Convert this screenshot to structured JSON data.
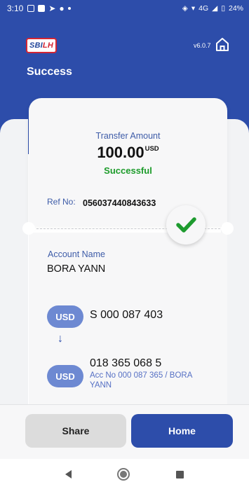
{
  "status_bar": {
    "time": "3:10",
    "network": "4G",
    "battery": "24%"
  },
  "header": {
    "logo_main": "SBI",
    "logo_accent": "LH",
    "version": "v6.0.7",
    "title": "Success",
    "home_icon": "home-icon"
  },
  "transfer": {
    "label": "Transfer Amount",
    "amount": "100.00",
    "currency": "USD",
    "status": "Successful"
  },
  "reference": {
    "label": "Ref No:",
    "value": "056037440843633"
  },
  "account": {
    "label": "Account Name",
    "name": "BORA YANN"
  },
  "from": {
    "currency": "USD",
    "account": "S 000 087 403"
  },
  "to": {
    "currency": "USD",
    "account": "018 365 068 5",
    "detail": "Acc No 000 087 365 / BORA YANN"
  },
  "buttons": {
    "share": "Share",
    "home": "Home"
  },
  "colors": {
    "primary": "#2d4daa",
    "success": "#1c9b2a",
    "pill": "#6d89d2",
    "logo_red": "#d32634"
  }
}
